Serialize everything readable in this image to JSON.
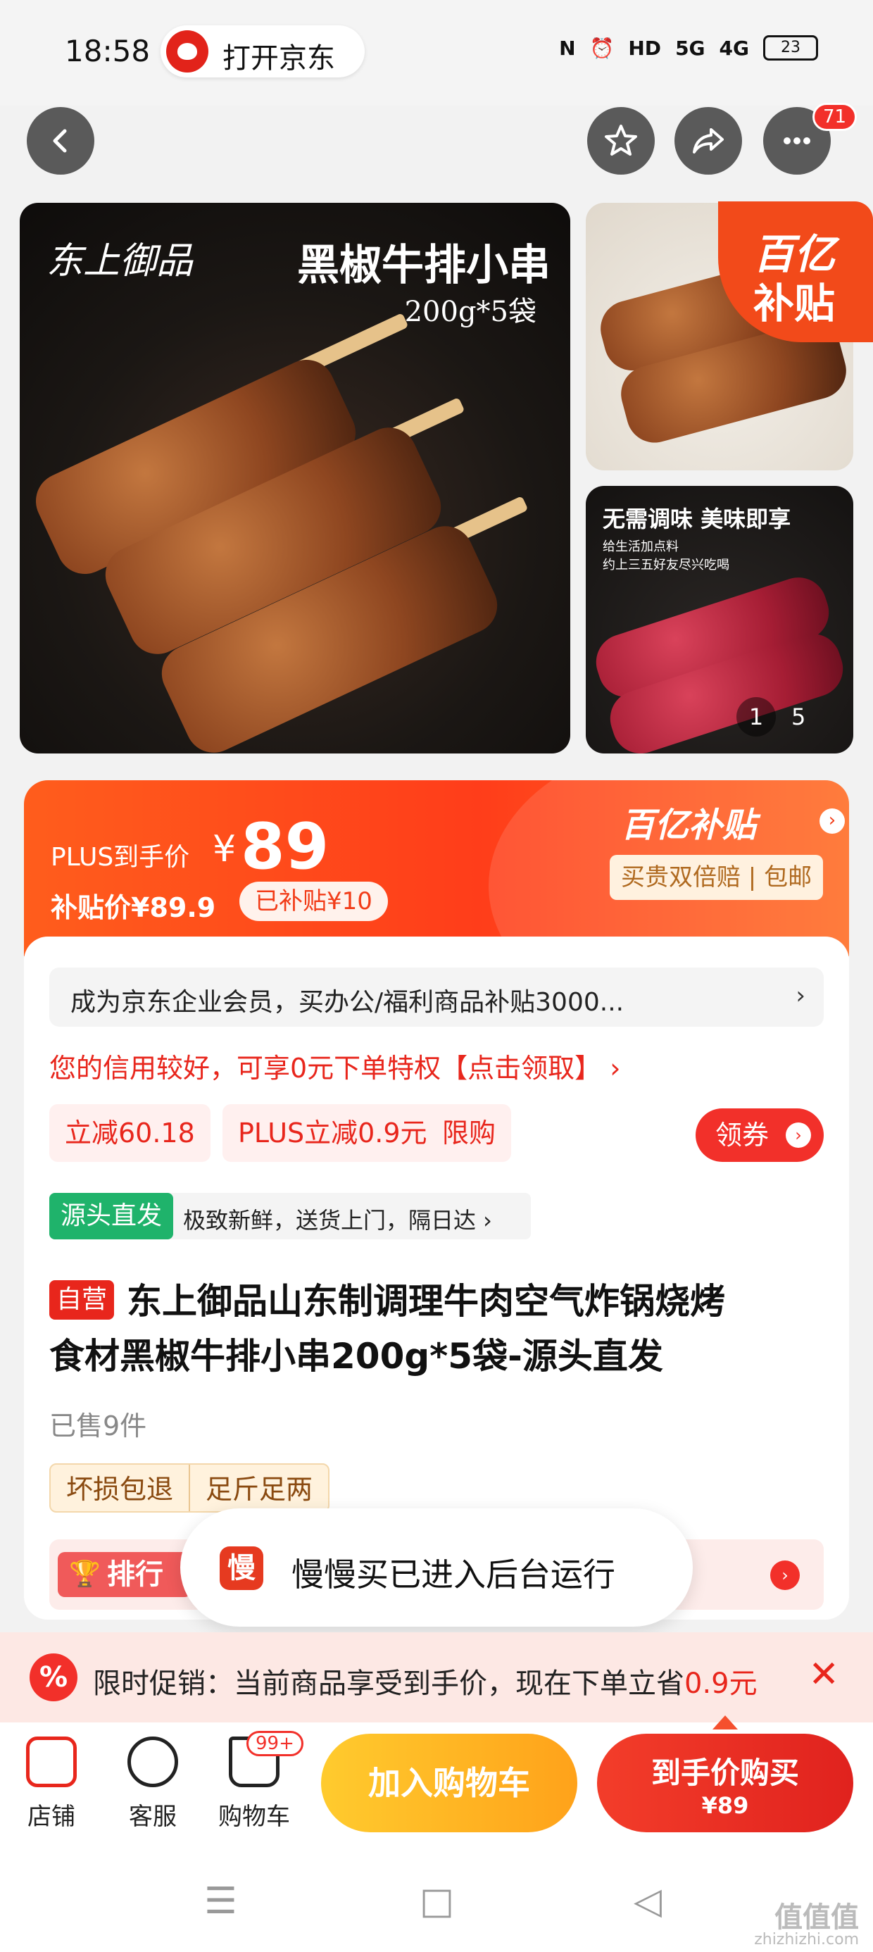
{
  "status_bar": {
    "time": "18:58",
    "open_app": "打开京东",
    "icons": [
      "N",
      "⏰",
      "HD",
      "5G",
      "4G"
    ],
    "battery": "23"
  },
  "nav": {
    "back_icon": "chevron-left-icon",
    "favorite_icon": "star-icon",
    "share_icon": "share-icon",
    "more_icon": "more-icon",
    "message_count": "71"
  },
  "gallery": {
    "brand": "东上御品",
    "title": "黑椒牛排小串",
    "spec": "200g*5袋",
    "subsidy_l1": "百亿",
    "subsidy_l2": "补贴",
    "thumb2_title": "无需调味 美味即享",
    "thumb2_sub1": "给生活加点料",
    "thumb2_sub2": "约上三五好友尽兴吃喝",
    "page_current": "1",
    "page_total": "5"
  },
  "price": {
    "plus_label": "PLUS到手价",
    "currency": "¥",
    "amount": "89",
    "subsidy_price": "补贴价¥89.9",
    "subsidy_badge": "已补贴¥10",
    "brand_label": "百亿补贴",
    "guarantee": "买贵双倍赔 | 包邮"
  },
  "details": {
    "business_promo": "成为京东企业会员，买办公/福利商品补贴3000...",
    "credit_promo": "您的信用较好，可享0元下单特权【点击领取】 ›",
    "tags": [
      "立减60.18",
      "PLUS立减0.9元",
      "限购"
    ],
    "coupon_button": "领券",
    "direct_badge": "源头直发",
    "direct_text": "极致新鲜，送货上门，隔日达 ›",
    "self_operated": "自营",
    "title_line1": "东上御品山东制调理牛肉空气炸锅烧烤",
    "title_line2": "食材黑椒牛排小串200g*5袋-源头直发",
    "sold": "已售9件",
    "services": [
      "坏损包退",
      "足斤足两"
    ],
    "rank_label": "排行"
  },
  "toast": {
    "icon": "慢",
    "text": "慢慢买已进入后台运行"
  },
  "promo_bar": {
    "icon": "%",
    "text": "限时促销：当前商品享受到手价，现在下单立省",
    "highlight": "0.9元",
    "close": "✕"
  },
  "bottom_bar": {
    "store": "店铺",
    "service": "客服",
    "cart": "购物车",
    "cart_badge": "99+",
    "add_to_cart": "加入购物车",
    "buy_now": "到手价购买",
    "buy_price": "¥89"
  },
  "watermark": {
    "main": "值值值",
    "sub": "zhizhizhi.com"
  },
  "colors": {
    "brand_red": "#f2302a",
    "price_orange": "#ff5d1c",
    "green_badge": "#1fb36b"
  }
}
